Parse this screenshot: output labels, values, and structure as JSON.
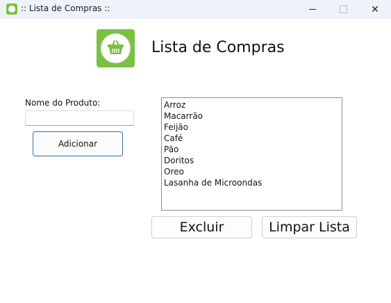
{
  "window": {
    "title": ":: Lista de Compras ::",
    "minimize_icon": "minimize-icon",
    "maximize_icon": "maximize-icon",
    "close_icon": "close-icon",
    "close_glyph": "✕"
  },
  "header": {
    "logo_icon": "basket-icon",
    "title": "Lista de Compras"
  },
  "form": {
    "label": "Nome do Produto:",
    "input_value": "",
    "input_placeholder": "",
    "add_label": "Adicionar"
  },
  "list": {
    "items": [
      "Arroz",
      "Macarrão",
      "Feijão",
      "Café",
      "Pão",
      "Doritos",
      "Oreo",
      "Lasanha de Microondas"
    ]
  },
  "actions": {
    "delete_label": "Excluir",
    "clear_label": "Limpar Lista"
  },
  "colors": {
    "accent_green": "#7ac142",
    "focus_border": "#2f6fb3"
  }
}
